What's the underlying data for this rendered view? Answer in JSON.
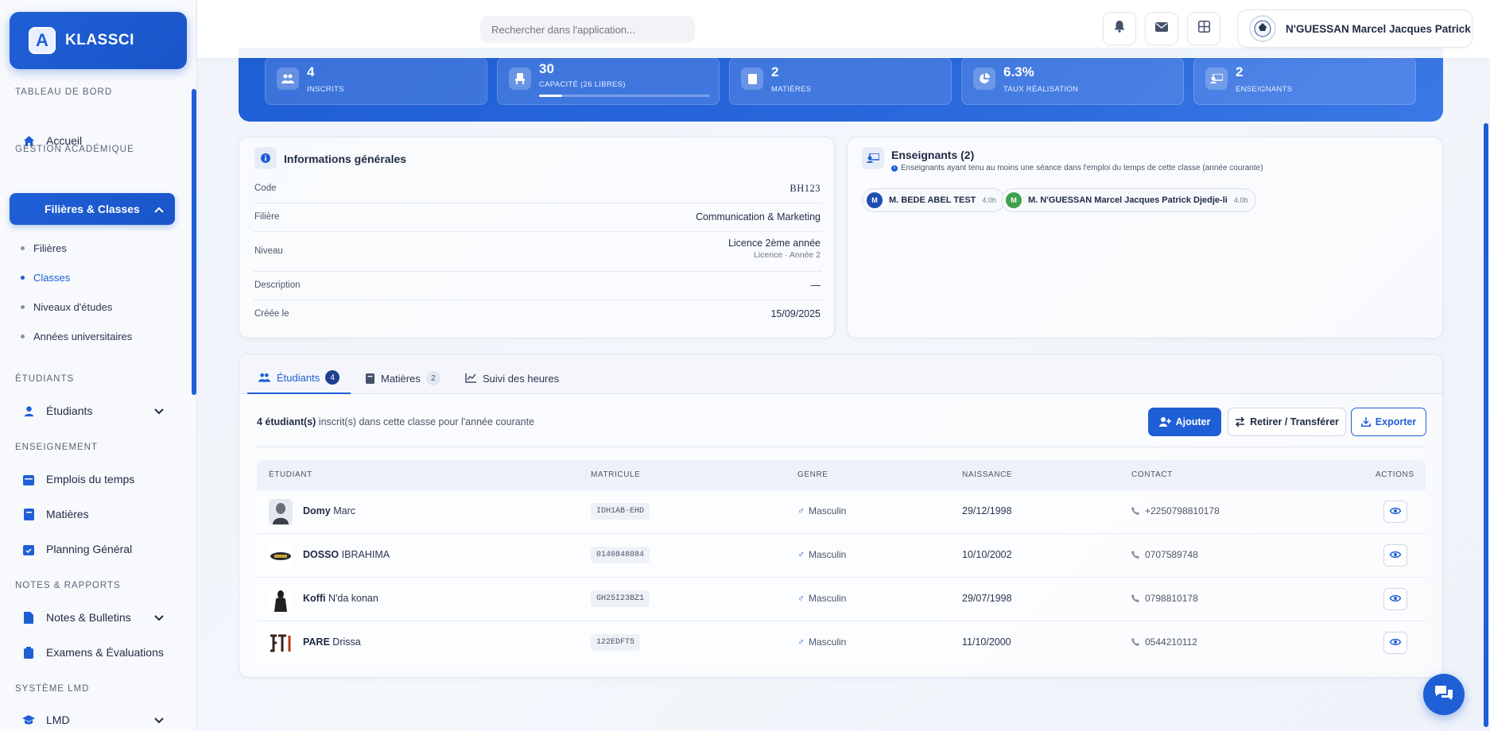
{
  "brand": {
    "name": "KLASSCI",
    "logo_letter": "A"
  },
  "search": {
    "placeholder": "Rechercher dans l'application..."
  },
  "user": {
    "name": "N'GUESSAN Marcel Jacques Patrick"
  },
  "sidebar": {
    "sections": [
      {
        "title": "TABLEAU DE BORD"
      },
      {
        "title": "GESTION ACADÉMIQUE"
      },
      {
        "title": "ÉTUDIANTS"
      },
      {
        "title": "ENSEIGNEMENT"
      },
      {
        "title": "NOTES & RAPPORTS"
      },
      {
        "title": "SYSTÈME LMD"
      }
    ],
    "items": {
      "accueil": "Accueil",
      "filieres_classes": "Filières & Classes",
      "etudiants": "Étudiants",
      "emplois": "Emplois du temps",
      "matieres": "Matières",
      "planning": "Planning Général",
      "notes": "Notes & Bulletins",
      "examens": "Examens & Évaluations",
      "lmd": "LMD"
    },
    "sub_items": [
      "Filières",
      "Classes",
      "Niveaux d'études",
      "Années universitaires"
    ]
  },
  "stats": [
    {
      "value": "4",
      "label": "INSCRITS",
      "icon": "users-icon"
    },
    {
      "value": "30",
      "label": "CAPACITÉ (26 LIBRES)",
      "icon": "chair-icon",
      "progress": 0.133
    },
    {
      "value": "2",
      "label": "MATIÈRES",
      "icon": "book-icon"
    },
    {
      "value": "6.3%",
      "label": "TAUX RÉALISATION",
      "icon": "pie-chart-icon"
    },
    {
      "value": "2",
      "label": "ENSEIGNANTS",
      "icon": "teacher-icon"
    }
  ],
  "info": {
    "title": "Informations générales",
    "rows": [
      {
        "key": "Code",
        "value": "BH123"
      },
      {
        "key": "Filière",
        "value": "Communication & Marketing"
      },
      {
        "key": "Niveau",
        "value": "Licence 2ème année",
        "sub": "Licence · Année 2"
      },
      {
        "key": "Description",
        "value": "—"
      },
      {
        "key": "Créée le",
        "value": "15/09/2025"
      }
    ]
  },
  "teachers": {
    "title": "Enseignants (2)",
    "subtitle": "Enseignants ayant tenu au moins une séance dans l'emploi du temps de cette classe (année courante)",
    "list": [
      {
        "initial": "M",
        "name": "M. BEDE ABEL TEST",
        "hours": "4.0h",
        "color": "#1f4fae"
      },
      {
        "initial": "M",
        "name": "M. N'GUESSAN Marcel Jacques Patrick Djedje-li",
        "hours": "4.0h",
        "color": "#3fa14a"
      }
    ]
  },
  "tabs": [
    {
      "label": "Étudiants",
      "badge": "4"
    },
    {
      "label": "Matières",
      "badge": "2"
    },
    {
      "label": "Suivi des heures"
    }
  ],
  "students_panel": {
    "count_bold": "4 étudiant(s)",
    "count_rest": " inscrit(s) dans cette classe pour l'année courante",
    "buttons": {
      "add": "Ajouter",
      "transfer": "Retirer / Transférer",
      "export": "Exporter"
    },
    "columns": [
      "ÉTUDIANT",
      "MATRICULE",
      "GENRE",
      "NAISSANCE",
      "CONTACT",
      "ACTIONS"
    ],
    "rows": [
      {
        "last": "Domy",
        "first": "Marc",
        "matricule": "IDH1AB-EHD",
        "genre": "Masculin",
        "naissance": "29/12/1998",
        "contact": "+2250798810178"
      },
      {
        "last": "DOSSO",
        "first": "IBRAHIMA",
        "matricule": "0140848084",
        "genre": "Masculin",
        "naissance": "10/10/2002",
        "contact": "0707589748"
      },
      {
        "last": "Koffi",
        "first": "N'da konan",
        "matricule": "GH25I23BZ1",
        "genre": "Masculin",
        "naissance": "29/07/1998",
        "contact": "0798810178"
      },
      {
        "last": "PARE",
        "first": "Drissa",
        "matricule": "122EDFT5",
        "genre": "Masculin",
        "naissance": "11/10/2000",
        "contact": "0544210112"
      }
    ]
  }
}
